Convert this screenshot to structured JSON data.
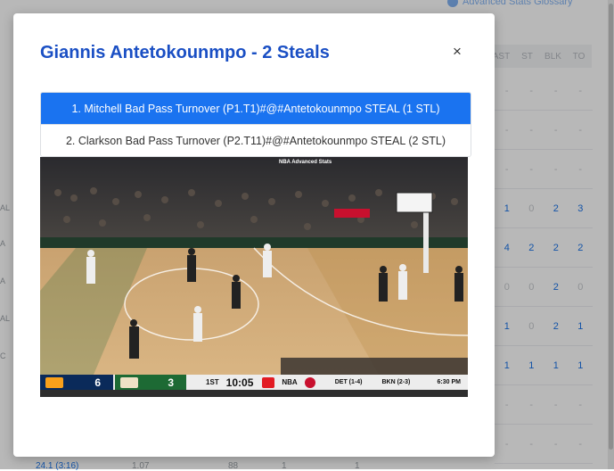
{
  "background": {
    "glossary_link": "Advanced Stats Glossary",
    "stat_headers": [
      "AST",
      "ST",
      "BLK",
      "TO"
    ],
    "rows": [
      {
        "values": [
          "-",
          "-",
          "-",
          "-"
        ],
        "highlight": [
          false,
          false,
          false,
          false
        ]
      },
      {
        "values": [
          "-",
          "-",
          "-",
          "-"
        ],
        "highlight": [
          false,
          false,
          false,
          false
        ]
      },
      {
        "values": [
          "-",
          "-",
          "-",
          "-"
        ],
        "highlight": [
          false,
          false,
          false,
          false
        ]
      },
      {
        "values": [
          "1",
          "0",
          "2",
          "3"
        ],
        "highlight": [
          true,
          false,
          true,
          true
        ]
      },
      {
        "values": [
          "4",
          "2",
          "2",
          "2"
        ],
        "highlight": [
          true,
          true,
          true,
          true
        ]
      },
      {
        "values": [
          "0",
          "0",
          "2",
          "0"
        ],
        "highlight": [
          false,
          false,
          true,
          false
        ]
      },
      {
        "values": [
          "1",
          "0",
          "2",
          "1"
        ],
        "highlight": [
          true,
          false,
          true,
          true
        ]
      },
      {
        "values": [
          "1",
          "1",
          "1",
          "1"
        ],
        "highlight": [
          true,
          true,
          true,
          true
        ]
      },
      {
        "values": [
          "-",
          "-",
          "-",
          "-"
        ],
        "highlight": [
          false,
          false,
          false,
          false
        ]
      },
      {
        "values": [
          "-",
          "-",
          "-",
          "-"
        ],
        "highlight": [
          false,
          false,
          false,
          false
        ]
      }
    ],
    "left_tags": [
      "AL",
      "A",
      "A",
      "AL",
      "C"
    ],
    "bottom_values": [
      "24.1 (3:16)",
      "1.07",
      "88",
      "1",
      "1"
    ]
  },
  "modal": {
    "title": "Giannis Antetokounmpo - 2 Steals",
    "close_label": "×",
    "plays": [
      "1. Mitchell Bad Pass Turnover (P1.T1)#@#Antetokounmpo STEAL (1 STL)",
      "2. Clarkson Bad Pass Turnover (P2.T11)#@#Antetokounmpo STEAL (2 STL)"
    ],
    "active_play_index": 0
  },
  "video": {
    "overlay_tag": "NBA Advanced Stats",
    "scorebug": {
      "away_score": "6",
      "home_score": "3",
      "quarter": "1ST",
      "clock": "10:05",
      "network": "NBA",
      "other_game_1": "DET (1-4)",
      "other_game_2": "BKN (2-3)",
      "other_time": "6:30 PM"
    }
  },
  "colors": {
    "title_blue": "#1a4fc4",
    "active_blue": "#1a73f0",
    "utah_navy": "#0a2a5a",
    "bucks_green": "#1d6a34"
  }
}
